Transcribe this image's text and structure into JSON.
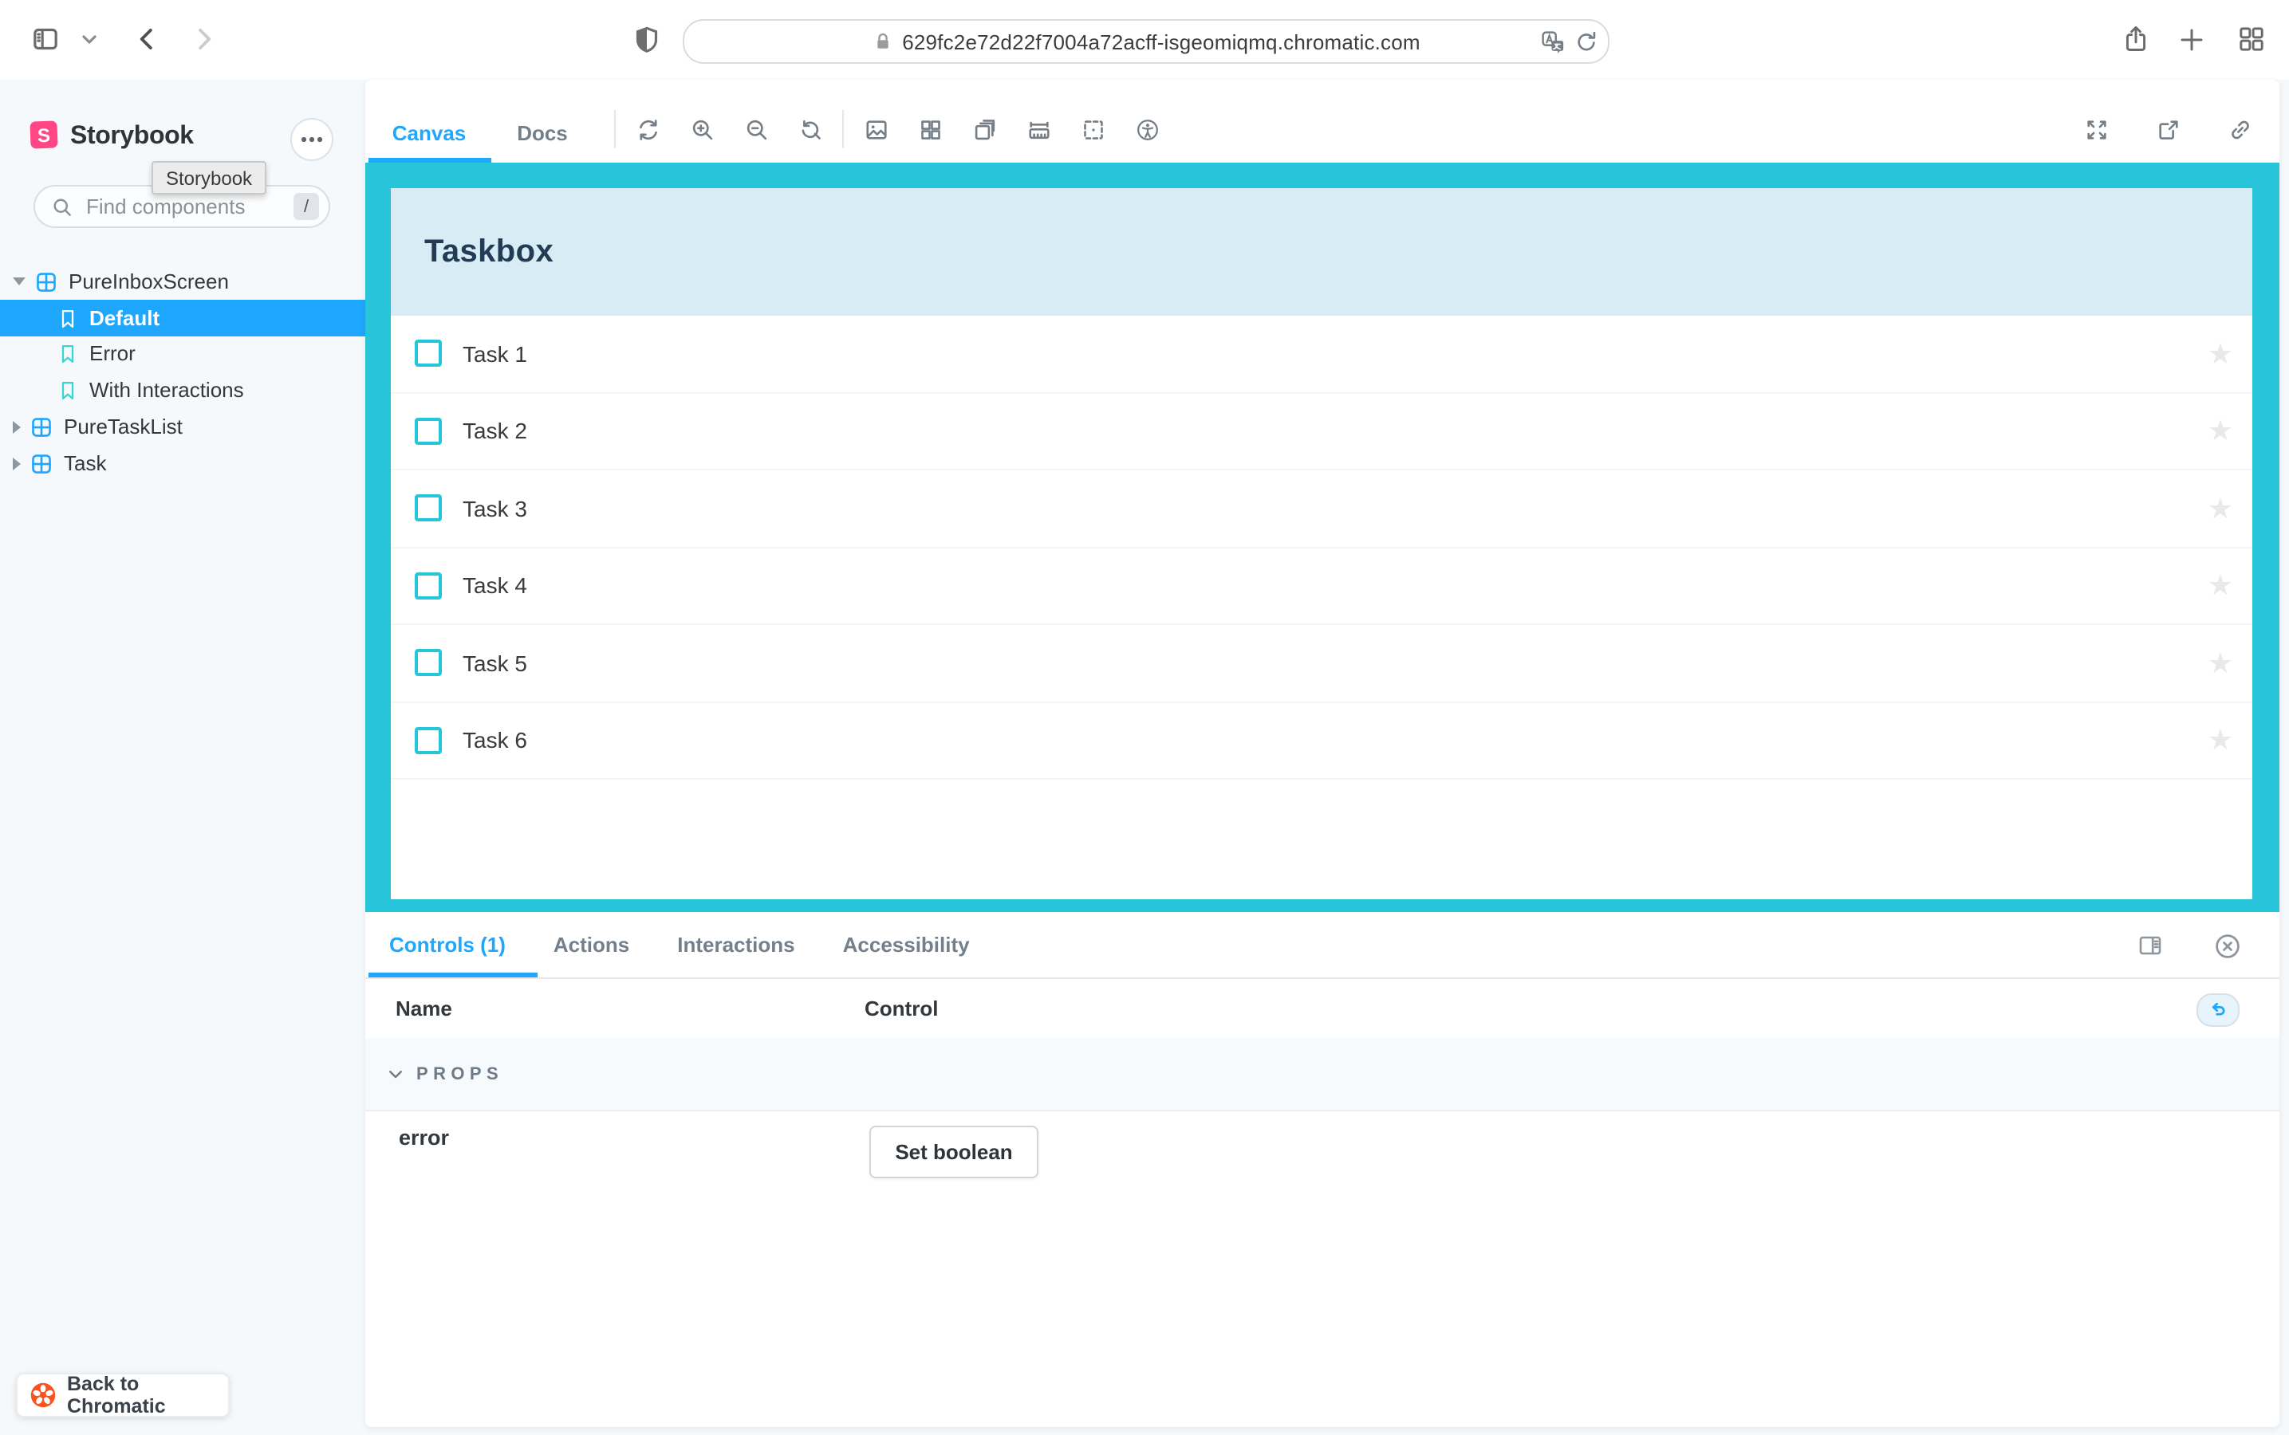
{
  "browser": {
    "url": "629fc2e72d22f7004a72acff-isgeomiqmq.chromatic.com",
    "left_icons": [
      "sidebar-toggle",
      "chevron-down",
      "back",
      "forward"
    ],
    "privacy_icon": "shield",
    "url_icons": [
      "lock",
      "translate",
      "reload"
    ],
    "right_icons": [
      "share",
      "new-tab",
      "tab-overview"
    ]
  },
  "sidebar": {
    "brand": "Storybook",
    "menu_icon": "ellipsis",
    "tooltip": "Storybook",
    "search": {
      "placeholder": "Find components",
      "shortcut_key": "/",
      "icon": "search-icon"
    },
    "tree": [
      {
        "label": "PureInboxScreen",
        "type": "component",
        "expanded": true
      },
      {
        "label": "Default",
        "type": "story",
        "selected": true
      },
      {
        "label": "Error",
        "type": "story",
        "selected": false
      },
      {
        "label": "With Interactions",
        "type": "story",
        "selected": false
      },
      {
        "label": "PureTaskList",
        "type": "component",
        "expanded": false
      },
      {
        "label": "Task",
        "type": "component",
        "expanded": false
      }
    ],
    "back_button": {
      "label": "Back to Chromatic",
      "icon": "chromatic-logo"
    }
  },
  "toolbar": {
    "tabs": [
      {
        "label": "Canvas",
        "active": true
      },
      {
        "label": "Docs",
        "active": false
      }
    ],
    "tool_icons": [
      "remount",
      "zoom-in",
      "zoom-out",
      "zoom-reset",
      "backgrounds",
      "grid",
      "viewport",
      "measure",
      "outline",
      "accessibility"
    ],
    "right_icons": [
      "fullscreen",
      "open-canvas-new-tab",
      "copy-link"
    ]
  },
  "preview": {
    "title": "Taskbox",
    "tasks": [
      "Task 1",
      "Task 2",
      "Task 3",
      "Task 4",
      "Task 5",
      "Task 6"
    ],
    "task_icons": {
      "left": "checkbox-unchecked",
      "right": "star"
    }
  },
  "panel": {
    "tabs": [
      {
        "label": "Controls (1)",
        "active": true
      },
      {
        "label": "Actions",
        "active": false
      },
      {
        "label": "Interactions",
        "active": false
      },
      {
        "label": "Accessibility",
        "active": false
      }
    ],
    "right_icons": [
      "panel-position",
      "close-panel"
    ],
    "columns": {
      "name": "Name",
      "control": "Control"
    },
    "reset_icon": "undo",
    "section_label": "PROPS",
    "rows": [
      {
        "name": "error",
        "control_button": "Set boolean"
      }
    ]
  },
  "colors": {
    "accent_blue": "#1EA7FD",
    "preview_cyan": "#28C4DA",
    "taskbox_header_bg": "#D7ECF4",
    "taskbox_title": "#223C55",
    "story_icon_teal": "#37D5D3",
    "brand_pink": "#FF4785",
    "chromatic_orange": "#FC521F",
    "app_bg": "#F6F9FC",
    "star_gray": "#E9E9E9"
  }
}
